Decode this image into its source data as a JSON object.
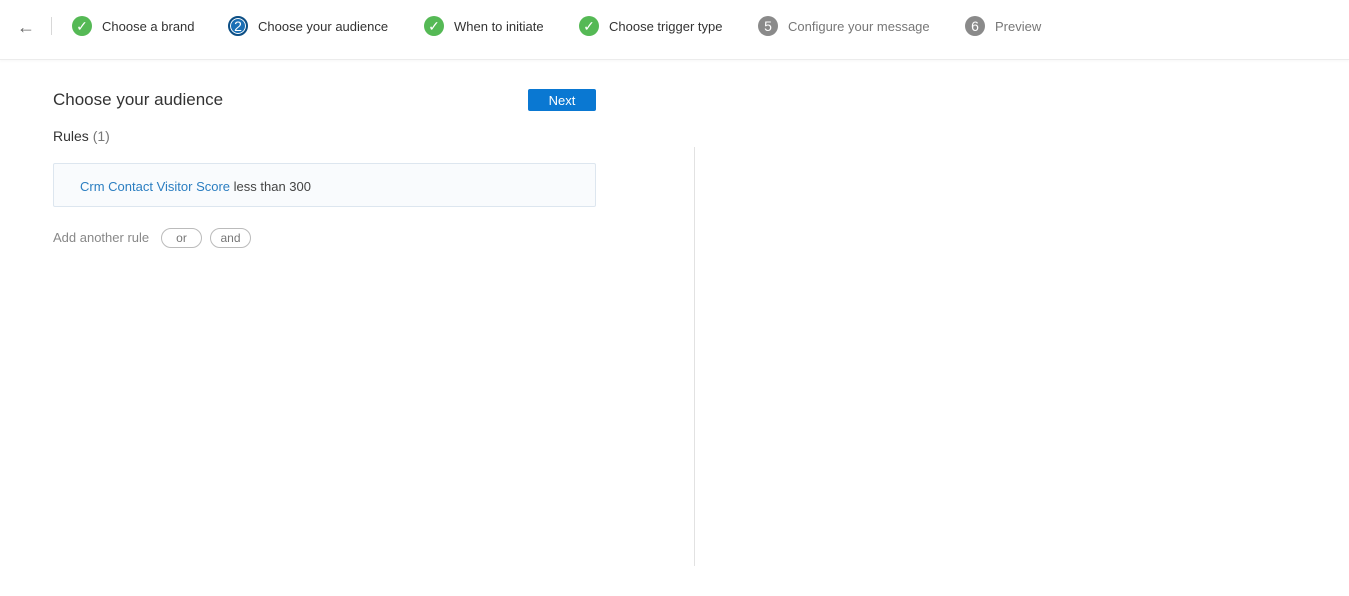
{
  "nav": {
    "back_icon": "arrow-left-icon",
    "steps": [
      {
        "label": "Choose a brand",
        "state": "done",
        "badge": "✓"
      },
      {
        "label": "Choose your audience",
        "state": "active",
        "badge": "2"
      },
      {
        "label": "When to initiate",
        "state": "done",
        "badge": "✓"
      },
      {
        "label": "Choose trigger type",
        "state": "done",
        "badge": "✓"
      },
      {
        "label": "Configure your message",
        "state": "todo",
        "badge": "5"
      },
      {
        "label": "Preview",
        "state": "todo",
        "badge": "6"
      }
    ]
  },
  "main": {
    "title": "Choose your audience",
    "next_label": "Next",
    "rules_label": "Rules",
    "rules_count": "(1)",
    "rules": [
      {
        "field": "Crm Contact Visitor Score",
        "condition": "less than 300"
      }
    ],
    "add_rule_label": "Add another rule",
    "or_label": "or",
    "and_label": "and"
  },
  "colors": {
    "accent": "#0a78d2",
    "done": "#55b955",
    "active": "#1a6fb5",
    "todo": "#8a8a8a",
    "link": "#2b7ec1"
  }
}
